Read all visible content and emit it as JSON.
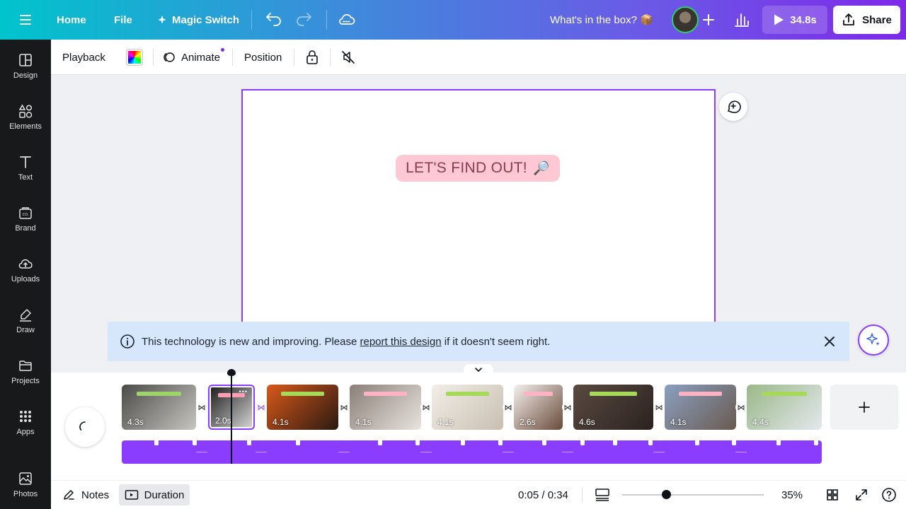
{
  "topbar": {
    "home_label": "Home",
    "file_label": "File",
    "magic_switch_label": "Magic Switch",
    "doc_title": "What's in the box? 📦",
    "play_label": "34.8s",
    "share_label": "Share"
  },
  "sidebar": {
    "items": [
      {
        "label": "Design",
        "icon": "design-icon"
      },
      {
        "label": "Elements",
        "icon": "elements-icon"
      },
      {
        "label": "Text",
        "icon": "text-icon"
      },
      {
        "label": "Brand",
        "icon": "brand-icon"
      },
      {
        "label": "Uploads",
        "icon": "uploads-icon"
      },
      {
        "label": "Draw",
        "icon": "draw-icon"
      },
      {
        "label": "Projects",
        "icon": "folder-icon"
      },
      {
        "label": "Apps",
        "icon": "apps-icon"
      },
      {
        "label": "Photos",
        "icon": "photos-icon"
      }
    ]
  },
  "toolbar": {
    "playback_label": "Playback",
    "animate_label": "Animate",
    "position_label": "Position"
  },
  "canvas": {
    "pill_text": "LET'S FIND OUT!",
    "pill_emoji": "🔎"
  },
  "banner": {
    "text_before": "This technology is new and improving. Please ",
    "link_text": "report this design",
    "text_after": " if it doesn't seem right."
  },
  "timeline": {
    "clips": [
      {
        "duration": "4.3s",
        "colors": [
          "#4a4a48",
          "#c8c6c0"
        ],
        "tag": "#9ed36a"
      },
      {
        "duration": "2.0s",
        "colors": [
          "#1a1a1a",
          "#d8d8d8"
        ],
        "tag": "#ff9fb5",
        "active": true
      },
      {
        "duration": "4.1s",
        "colors": [
          "#d9581a",
          "#2a1a12"
        ],
        "tag": "#a6d85a"
      },
      {
        "duration": "4.1s",
        "colors": [
          "#8a7f78",
          "#e9e4df"
        ],
        "tag": "#ffb2c4"
      },
      {
        "duration": "4.1s",
        "colors": [
          "#f2eee8",
          "#c8bfb0"
        ],
        "tag": "#a6d85a"
      },
      {
        "duration": "2.6s",
        "colors": [
          "#f4f1ee",
          "#6a4a3a"
        ],
        "tag": "#ffb2c4"
      },
      {
        "duration": "4.6s",
        "colors": [
          "#5a4a40",
          "#2a2220"
        ],
        "tag": "#a6d85a"
      },
      {
        "duration": "4.1s",
        "colors": [
          "#8aa0c0",
          "#6a5a50"
        ],
        "tag": "#ffb2c4"
      },
      {
        "duration": "4.4s",
        "colors": [
          "#9ab888",
          "#e4e8ee"
        ],
        "tag": "#a6d85a"
      }
    ]
  },
  "bottombar": {
    "notes_label": "Notes",
    "duration_label": "Duration",
    "time_readout": "0:05 / 0:34",
    "zoom_level": "35%"
  },
  "colors": {
    "accent": "#8b3dff",
    "sidebar_bg": "#18191b",
    "banner_bg": "#d6e6fb"
  }
}
